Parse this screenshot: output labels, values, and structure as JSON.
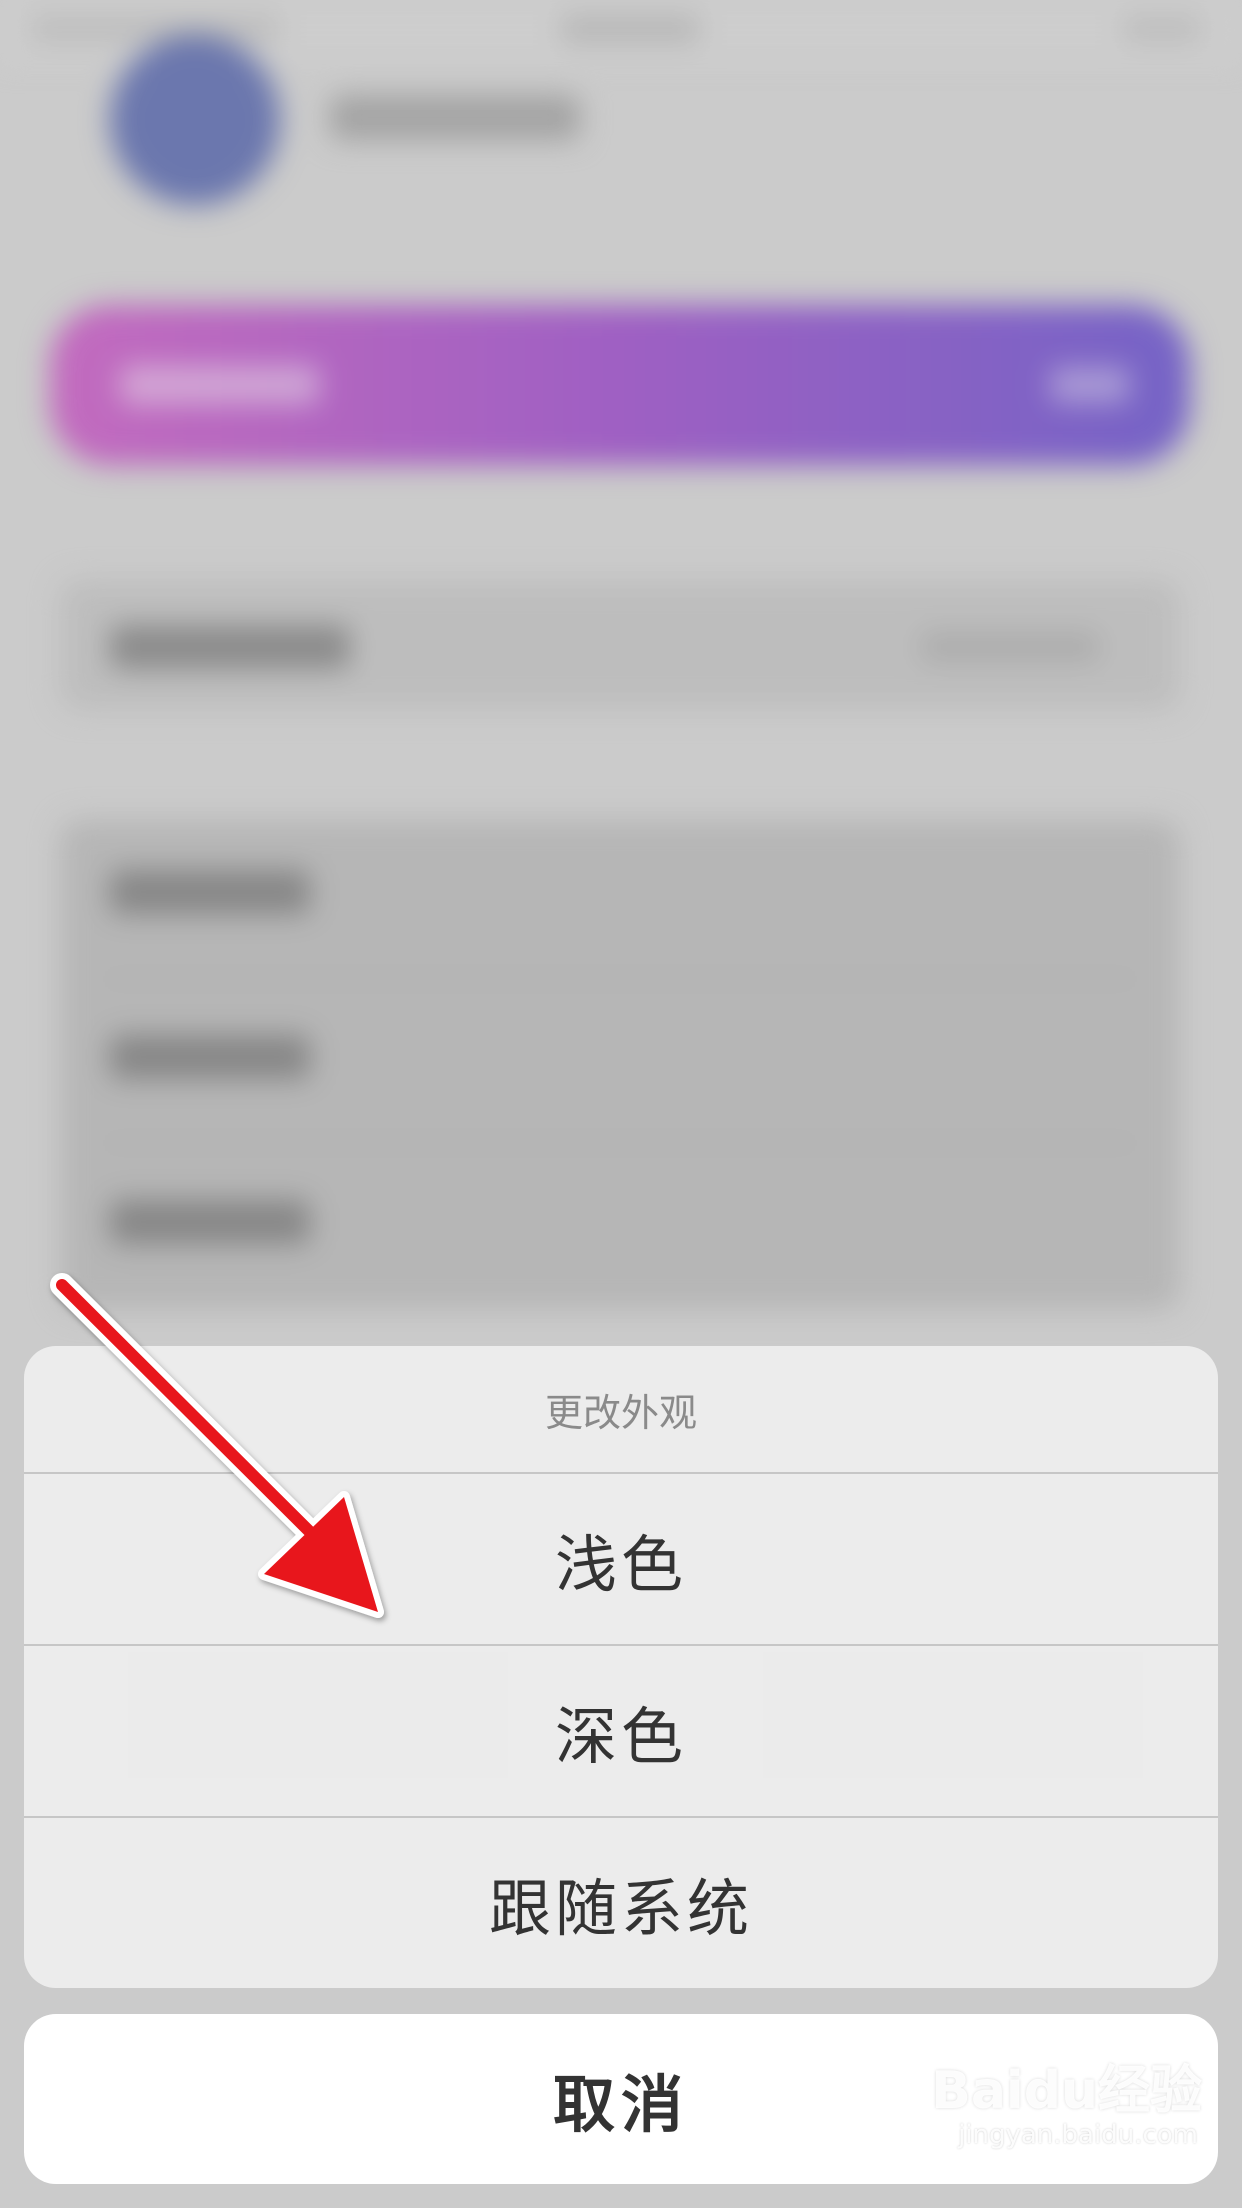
{
  "action_sheet": {
    "title": "更改外观",
    "options": [
      {
        "label": "浅色"
      },
      {
        "label": "深色"
      },
      {
        "label": "跟随系统"
      }
    ],
    "cancel_label": "取消"
  },
  "watermark": {
    "logo_text": "Baidu经验",
    "url": "jingyan.baidu.com"
  },
  "colors": {
    "annotation_arrow": "#e8141b",
    "vip_banner_start": "#c44fbe",
    "vip_banner_end": "#5c45c8"
  }
}
